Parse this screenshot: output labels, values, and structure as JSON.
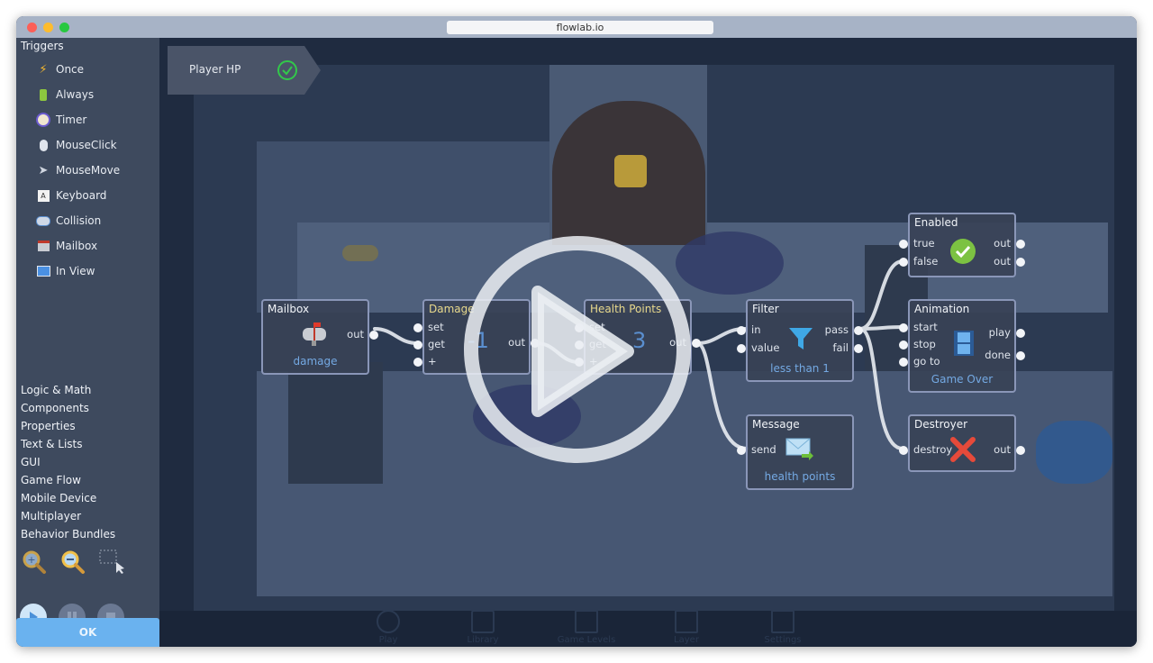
{
  "browser": {
    "url": "flowlab.io"
  },
  "sidebar": {
    "heading": "Triggers",
    "triggers": [
      {
        "label": "Once",
        "icon": "lightning-icon"
      },
      {
        "label": "Always",
        "icon": "battery-icon"
      },
      {
        "label": "Timer",
        "icon": "alarm-clock-icon"
      },
      {
        "label": "MouseClick",
        "icon": "mouse-icon"
      },
      {
        "label": "MouseMove",
        "icon": "cursor-icon"
      },
      {
        "label": "Keyboard",
        "icon": "keyboard-key-icon"
      },
      {
        "label": "Collision",
        "icon": "collision-icon"
      },
      {
        "label": "Mailbox",
        "icon": "mailbox-icon"
      },
      {
        "label": "In View",
        "icon": "monitor-icon"
      }
    ],
    "categories": [
      "Logic & Math",
      "Components",
      "Properties",
      "Text & Lists",
      "GUI",
      "Game Flow",
      "Mobile Device",
      "Multiplayer",
      "Behavior Bundles"
    ],
    "ok_label": "OK"
  },
  "behavior_badge": {
    "label": "Player HP",
    "status": "enabled"
  },
  "nodes": {
    "mailbox": {
      "title": "Mailbox",
      "out": "out",
      "sub": "damage"
    },
    "damage": {
      "title": "Damage",
      "ports": [
        "set",
        "get",
        "+"
      ],
      "value": "-1",
      "out": "out"
    },
    "health": {
      "title": "Health Points",
      "ports": [
        "set",
        "get",
        "+"
      ],
      "value": "3",
      "out": "out"
    },
    "filter": {
      "title": "Filter",
      "in": [
        "in",
        "value"
      ],
      "out": [
        "pass",
        "fail"
      ],
      "sub": "less than 1"
    },
    "enabled": {
      "title": "Enabled",
      "in": [
        "true",
        "false"
      ],
      "out": [
        "out",
        "out"
      ]
    },
    "animation": {
      "title": "Animation",
      "in": [
        "start",
        "stop",
        "go to"
      ],
      "out": [
        "play",
        "done"
      ],
      "sub": "Game Over"
    },
    "message": {
      "title": "Message",
      "in": [
        "send"
      ],
      "sub": "health points"
    },
    "destroyer": {
      "title": "Destroyer",
      "in": [
        "destroy"
      ],
      "out": [
        "out"
      ]
    }
  },
  "bottom_toolbar": [
    "Play",
    "Library",
    "Game Levels",
    "Layer",
    "Settings"
  ],
  "colors": {
    "accent": "#6ab2ef",
    "link": "#74a9e3",
    "success": "#32c84a"
  }
}
